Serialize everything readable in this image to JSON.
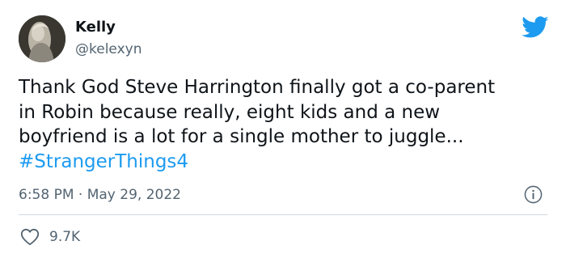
{
  "tweet": {
    "author": {
      "display_name": "Kelly",
      "handle": "@kelexyn",
      "avatar_icon": "avatar-photo"
    },
    "text_lines": [
      "Thank God Steve Harrington finally got a co-parent",
      "in Robin because really, eight kids and a new",
      "boyfriend is a lot for a single mother to juggle..."
    ],
    "hashtag": "#StrangerThings4",
    "timestamp": {
      "time": "6:58 PM",
      "separator": "·",
      "date": "May 29, 2022"
    },
    "likes": "9.7K",
    "icons": {
      "brand": "twitter-bird-icon",
      "info": "info-icon",
      "like": "heart-icon"
    }
  },
  "colors": {
    "brand_blue": "#1d9bf0",
    "text_primary": "#0f1419",
    "text_secondary": "#536471",
    "divider": "#cfd9de"
  }
}
